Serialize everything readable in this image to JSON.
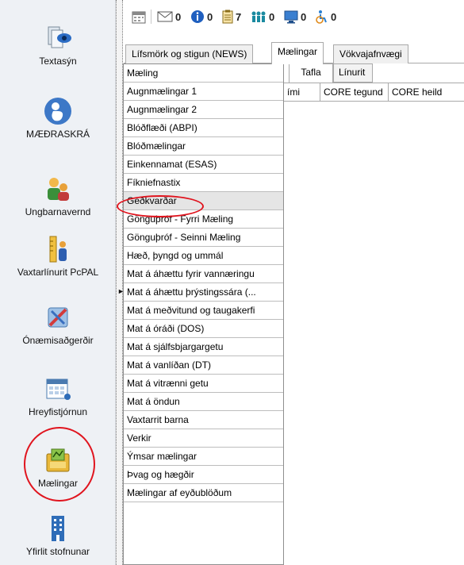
{
  "toolbar": {
    "items": [
      {
        "icon": "calendar-icon",
        "count": ""
      },
      {
        "icon": "mail-icon",
        "count": "0"
      },
      {
        "icon": "info-icon",
        "count": "0"
      },
      {
        "icon": "clipboard-icon",
        "count": "7"
      },
      {
        "icon": "people-icon",
        "count": "0"
      },
      {
        "icon": "monitor-icon",
        "count": "0"
      },
      {
        "icon": "wheelchair-icon",
        "count": "0"
      }
    ]
  },
  "leftnav": {
    "items": [
      {
        "label": "Textasýn",
        "icon": "eye-document-icon"
      },
      {
        "label": "MÆÐRASKRÁ",
        "icon": "pregnancy-icon"
      },
      {
        "label": "Ungbarnavernd",
        "icon": "parent-child-icon"
      },
      {
        "label": "Vaxtarlínurit PcPAL",
        "icon": "growth-ruler-icon"
      },
      {
        "label": "Ónæmisaðgerðir",
        "icon": "syringe-icon"
      },
      {
        "label": "Hreyfistjórnun",
        "icon": "calendar-grid-icon"
      },
      {
        "label": "Mælingar",
        "icon": "measurement-folder-icon"
      },
      {
        "label": "Yfirlit stofnunar",
        "icon": "building-icon"
      }
    ]
  },
  "tabs": [
    "Lífsmörk og stigun (NEWS)",
    "Mælingar",
    "Vökvajafnvægi"
  ],
  "list": {
    "header": "Mæling",
    "items": [
      "Augnmælingar 1",
      "Augnmælingar 2",
      "Blóðflæði (ABPI)",
      "Blóðmælingar",
      "Einkennamat (ESAS)",
      "Fíkniefnastix",
      "Geðkvarðar",
      "Gönguþróf - Fyrri Mæling",
      "Gönguþróf - Seinni Mæling",
      "Hæð, þyngd og ummál",
      "Mat á áhættu fyrir vannæringu",
      "Mat á áhættu þrýstingssára (...",
      "Mat á meðvitund og taugakerfi",
      "Mat á óráði (DOS)",
      "Mat á sjálfsbjargargetu",
      "Mat á vanlíðan (DT)",
      "Mat á vitrænni getu",
      "Mat á öndun",
      "Vaxtarrit barna",
      "Verkir",
      "Ýmsar mælingar",
      "Þvag og hægðir",
      "Mælingar af eyðublöðum"
    ]
  },
  "subtabs": [
    "Tafla",
    "Línurit"
  ],
  "grid": {
    "columns": [
      "ími",
      "CORE tegund",
      "CORE heild"
    ]
  },
  "colors": {
    "highlight": "#e0141e",
    "selected_row": "#e5e5e5"
  }
}
